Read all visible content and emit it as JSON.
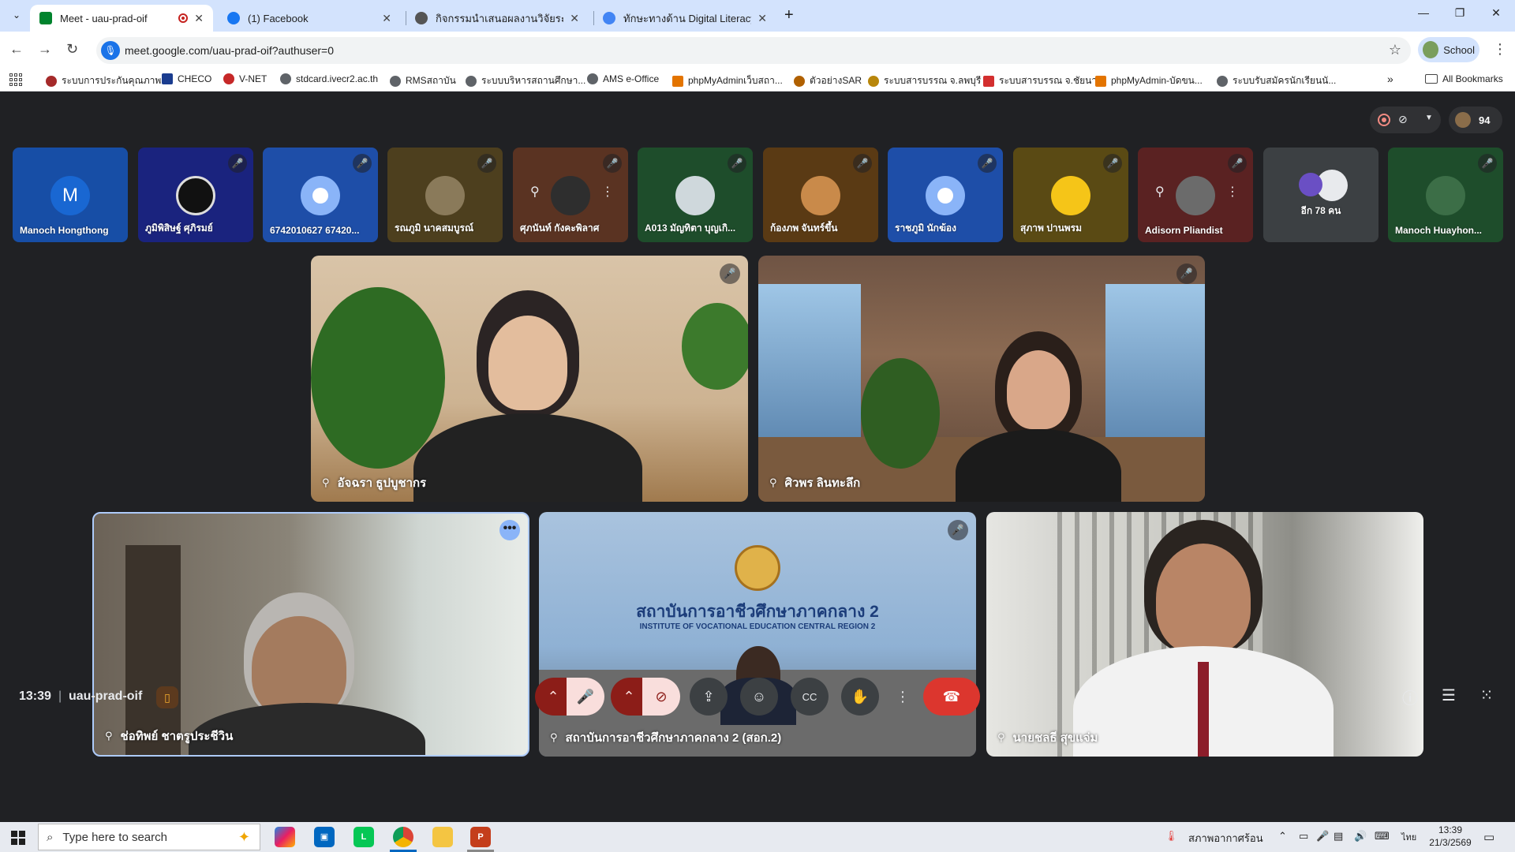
{
  "browser": {
    "tabs": [
      {
        "title": "Meet - uau-prad-oif",
        "active": true,
        "favicon_color": "#00832d"
      },
      {
        "title": "(1) Facebook",
        "active": false,
        "favicon_color": "#1877f2"
      },
      {
        "title": "กิจกรรมนำเสนอผลงานวิจัยระดับปริญ",
        "active": false,
        "favicon_color": "#555555"
      },
      {
        "title": "ทักษะทางด้าน Digital Literacy - G",
        "active": false,
        "favicon_color": "#4285f4"
      }
    ],
    "url": "meet.google.com/uau-prad-oif?authuser=0",
    "profile_label": "School",
    "bookmarks": [
      {
        "label": "ระบบการประกันคุณภาพ",
        "color": "#a52a2a"
      },
      {
        "label": "CHECO",
        "color": "#1a3c8f"
      },
      {
        "label": "V-NET",
        "color": "#c62828"
      },
      {
        "label": "stdcard.ivecr2.ac.th",
        "color": "#5f6368"
      },
      {
        "label": "RMSสถาบัน",
        "color": "#5f6368"
      },
      {
        "label": "ระบบบริหารสถานศึกษา...",
        "color": "#5f6368"
      },
      {
        "label": "AMS e-Office",
        "color": "#5f6368"
      },
      {
        "label": "phpMyAdminเว็บสถา...",
        "color": "#e37400"
      },
      {
        "label": "ตัวอย่างSAR",
        "color": "#b06000"
      },
      {
        "label": "ระบบสารบรรณ จ.ลพบุรี",
        "color": "#b8860b"
      },
      {
        "label": "ระบบสารบรรณ จ.ชัยนาท",
        "color": "#d32f2f"
      },
      {
        "label": "phpMyAdmin-บัดขน...",
        "color": "#e37400"
      },
      {
        "label": "ระบบรับสมัครนักเรียนนั...",
        "color": "#5f6368"
      }
    ],
    "all_bookmarks_label": "All Bookmarks"
  },
  "meet": {
    "people_count": "94",
    "strip": [
      {
        "name": "Manoch Hongthong",
        "bg": "#174ea6",
        "avatar": "M",
        "avatar_bg": "#1967d2",
        "muted": false
      },
      {
        "name": "ภูมิพิสิษฐ์ ศุภิรมย์",
        "bg": "#1a237e",
        "avatar": "",
        "avatar_bg": "#111111",
        "muted": true
      },
      {
        "name": "6742010627 67420...",
        "bg": "#1e4ea8",
        "avatar": "",
        "avatar_bg": "#8ab4f8",
        "muted": true
      },
      {
        "name": "รณภูมิ นาคสมบูรณ์",
        "bg": "#4d3f1e",
        "avatar": "",
        "avatar_bg": "#8a7a5a",
        "muted": true
      },
      {
        "name": "ศุภนันท์ กังคะพิลาศ",
        "bg": "#5a3322",
        "avatar": "",
        "avatar_bg": "#2e2e2e",
        "muted": true
      },
      {
        "name": "A013 มัญทิตา บุญเกิ...",
        "bg": "#1e4d2b",
        "avatar": "",
        "avatar_bg": "#cfd8dc",
        "muted": true
      },
      {
        "name": "ก้องภพ จันทร์ขึ้น",
        "bg": "#5a3a14",
        "avatar": "",
        "avatar_bg": "#c98a4a",
        "muted": true
      },
      {
        "name": "ราชภูมิ นักฆ้อง",
        "bg": "#1e4ea8",
        "avatar": "",
        "avatar_bg": "#8ab4f8",
        "muted": true
      },
      {
        "name": "สุภาพ ปานพรม",
        "bg": "#5a4a14",
        "avatar": "",
        "avatar_bg": "#f5c518",
        "muted": true
      },
      {
        "name": "Adisorn Pliandist",
        "bg": "#5a2222",
        "avatar": "",
        "avatar_bg": "#6b6b6b",
        "muted": true
      },
      {
        "name": "อีก 78 คน",
        "bg": "#3c4043",
        "avatar": "",
        "avatar_bg": "#e8eaed",
        "muted": false
      },
      {
        "name": "Manoch Huayhon...",
        "bg": "#1e4d2b",
        "avatar": "",
        "avatar_bg": "#3c6e47",
        "muted": true
      }
    ],
    "videos": [
      {
        "name": "อัจฉรา ธูปบูชากร",
        "muted": true
      },
      {
        "name": "ศิวพร ลินทะลึก",
        "muted": true
      },
      {
        "name": "ช่อทิพย์ ชาตรูประชีวิน",
        "muted": false
      },
      {
        "name": "สถาบันการอาชีวศึกษาภาคกลาง 2 (สอก.2)",
        "muted": true
      },
      {
        "name": "นายชลธี สุขแจ่ม",
        "muted": false
      }
    ],
    "banner_thai": "สถาบันการอาชีวศึกษาภาคกลาง 2",
    "banner_en": "INSTITUTE OF VOCATIONAL EDUCATION CENTRAL REGION 2",
    "clock": "13:39",
    "code": "uau-prad-oif"
  },
  "taskbar": {
    "search_placeholder": "Type here to search",
    "weather": "สภาพอากาศร้อน",
    "lang": "ไทย",
    "time": "13:39",
    "date": "21/3/2569"
  }
}
